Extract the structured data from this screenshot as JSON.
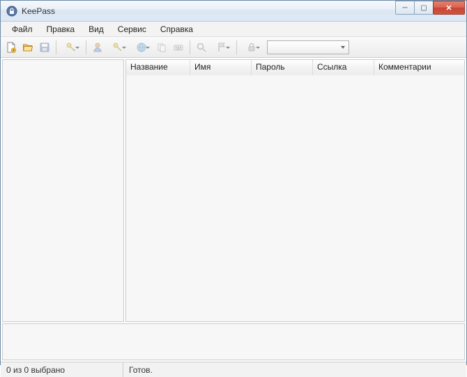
{
  "titlebar": {
    "title": "KeePass"
  },
  "menu": {
    "file": "Файл",
    "edit": "Правка",
    "view": "Вид",
    "tools": "Сервис",
    "help": "Справка"
  },
  "columns": {
    "title": "Название",
    "user": "Имя",
    "password": "Пароль",
    "url": "Ссылка",
    "notes": "Комментарии"
  },
  "status": {
    "selected": "0 из 0 выбрано",
    "ready": "Готов."
  }
}
